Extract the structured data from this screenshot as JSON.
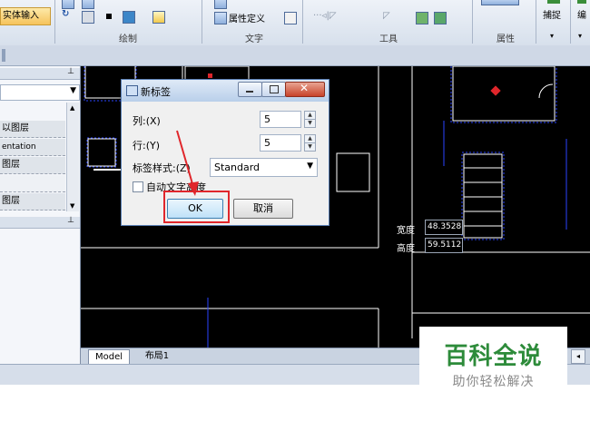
{
  "ribbon": {
    "entity_input_label": "实体输入",
    "groups": [
      "绘制",
      "文字",
      "工具",
      "属性"
    ],
    "attr_define_label": "属性定义",
    "snap_label": "捕捉",
    "edit_label": "编"
  },
  "left_panel": {
    "items": [
      "以图层",
      "entation",
      "图层",
      "图层"
    ]
  },
  "dialog": {
    "title": "新标签",
    "cols_label": "列:(X)",
    "cols_value": "5",
    "rows_label": "行:(Y)",
    "rows_value": "5",
    "style_label": "标签样式:(Z)",
    "style_value": "Standard",
    "auto_height_label": "自动文字高度",
    "ok_label": "OK",
    "cancel_label": "取消"
  },
  "canvas": {
    "width_label": "宽度",
    "width_value": "48.3528",
    "height_label": "高度",
    "height_value": "59.5112"
  },
  "tabs": [
    "Model",
    "布局1"
  ],
  "watermark": {
    "title": "百科全说",
    "subtitle": "助你轻松解决"
  },
  "colors": {
    "highlight_red": "#e0262b",
    "canvas_bg": "#000000",
    "watermark_green": "#2d8b3a"
  }
}
